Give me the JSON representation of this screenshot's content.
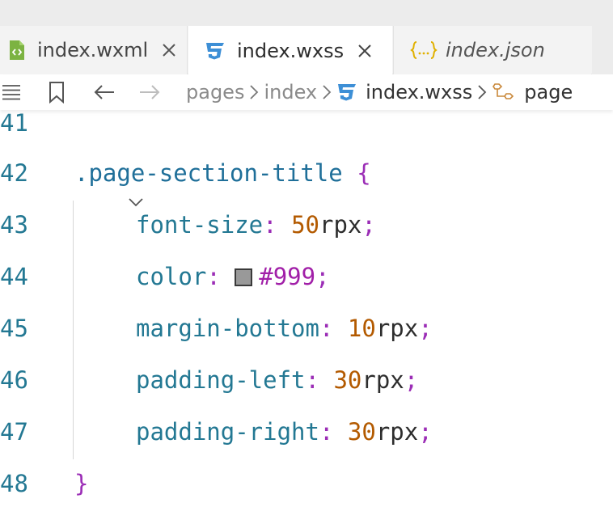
{
  "tabs": [
    {
      "label": "index.wxml",
      "icon": "wxml-file-icon",
      "active": false,
      "closable": true
    },
    {
      "label": "index.wxss",
      "icon": "css3-file-icon",
      "active": true,
      "closable": true
    },
    {
      "label": "index.json",
      "icon": "json-braces-icon",
      "active": false,
      "closable": false
    }
  ],
  "breadcrumb": {
    "items": [
      "pages",
      "index",
      "index.wxss",
      "page"
    ],
    "icons": [
      "menu-icon",
      "bookmark-icon",
      "back-arrow-icon",
      "forward-arrow-icon",
      "chevron-right-icon",
      "css3-file-icon",
      "symbol-class-icon"
    ]
  },
  "editor": {
    "lines": [
      {
        "number": "41"
      },
      {
        "number": "42",
        "selector": ".page-section-title",
        "brace": "{"
      },
      {
        "number": "43",
        "property": "font-size",
        "colon": ":",
        "num": "50",
        "unit": "rpx",
        "semi": ";"
      },
      {
        "number": "44",
        "property": "color",
        "colon": ":",
        "hex": "#999",
        "semi": ";"
      },
      {
        "number": "45",
        "property": "margin-bottom",
        "colon": ":",
        "num": "10",
        "unit": "rpx",
        "semi": ";"
      },
      {
        "number": "46",
        "property": "padding-left",
        "colon": ":",
        "num": "30",
        "unit": "rpx",
        "semi": ";"
      },
      {
        "number": "47",
        "property": "padding-right",
        "colon": ":",
        "num": "30",
        "unit": "rpx",
        "semi": ";"
      },
      {
        "number": "48",
        "brace": "}"
      }
    ],
    "swatch_color": "#999999"
  },
  "colors": {
    "selector": "#1f6f99",
    "property": "#237893",
    "punctuation": "#9b2db6",
    "number": "#b35a00",
    "hex": "#a11fa8",
    "line_number": "#237893",
    "css_icon": "#3d8fd6",
    "wxml_icon": "#7cb342",
    "json_icon": "#e0b000"
  }
}
